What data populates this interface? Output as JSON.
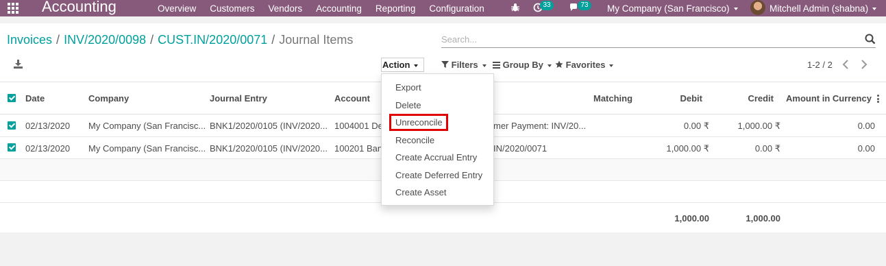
{
  "navbar": {
    "brand": "Accounting",
    "menu": [
      "Overview",
      "Customers",
      "Vendors",
      "Accounting",
      "Reporting",
      "Configuration"
    ],
    "activity_count": "33",
    "messages_count": "73",
    "company": "My Company (San Francisco)",
    "user": "Mitchell Admin (shabna)"
  },
  "breadcrumb": {
    "items": [
      "Invoices",
      "INV/2020/0098",
      "CUST.IN/2020/0071"
    ],
    "current": "Journal Items"
  },
  "search": {
    "placeholder": "Search..."
  },
  "toolbar": {
    "action_label": "Action",
    "filters_label": "Filters",
    "group_by_label": "Group By",
    "favorites_label": "Favorites",
    "pager": "1-2 / 2"
  },
  "action_menu": {
    "items": [
      "Export",
      "Delete",
      "Unreconcile",
      "Reconcile",
      "Create Accrual Entry",
      "Create Deferred Entry",
      "Create Asset"
    ],
    "highlighted": "Unreconcile"
  },
  "table": {
    "columns": [
      "Date",
      "Company",
      "Journal Entry",
      "Account",
      "Matching",
      "Debit",
      "Credit",
      "Amount in Currency"
    ],
    "rows": [
      {
        "date": "02/13/2020",
        "company": "My Company (San Francisc...",
        "journal_entry": "BNK1/2020/0105 (INV/2020...",
        "account": "1004001 De",
        "label": "mer Payment: INV/20...",
        "debit": "0.00 ₹",
        "credit": "1,000.00 ₹",
        "amount_currency": "0.00"
      },
      {
        "date": "02/13/2020",
        "company": "My Company (San Francisc...",
        "journal_entry": "BNK1/2020/0105 (INV/2020...",
        "account": "100201 Ban",
        "label": "IN/2020/0071",
        "debit": "1,000.00 ₹",
        "credit": "0.00 ₹",
        "amount_currency": "0.00"
      }
    ],
    "totals": {
      "debit": "1,000.00",
      "credit": "1,000.00"
    }
  },
  "colors": {
    "navbar": "#875a7b",
    "accent": "#00a09d",
    "highlight": "#e00000"
  }
}
